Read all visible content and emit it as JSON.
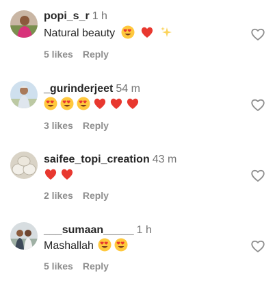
{
  "comments": [
    {
      "username": "popi_s_r",
      "time": "1 h",
      "text": "Natural beauty",
      "emojis": [
        "heart-eyes-emoji",
        "red-heart-emoji",
        "sparkles-emoji"
      ],
      "likes": "5 likes",
      "reply": "Reply"
    },
    {
      "username": "_gurinderjeet",
      "time": "54 m",
      "text": "",
      "emojis": [
        "heart-eyes-emoji",
        "heart-eyes-emoji",
        "heart-eyes-emoji",
        "red-heart-emoji",
        "red-heart-emoji",
        "red-heart-emoji"
      ],
      "likes": "3 likes",
      "reply": "Reply"
    },
    {
      "username": "saifee_topi_creation",
      "time": "43 m",
      "text": "",
      "emojis": [
        "red-heart-emoji",
        "red-heart-emoji"
      ],
      "likes": "2 likes",
      "reply": "Reply"
    },
    {
      "username": "___sumaan_____",
      "time": "1 h",
      "text": "Mashallah",
      "emojis": [
        "heart-eyes-emoji",
        "heart-eyes-emoji"
      ],
      "likes": "5 likes",
      "reply": "Reply"
    }
  ],
  "colors": {
    "username": "#262626",
    "secondary": "#8e8e8e",
    "heart": "#e8382f",
    "emoji_face": "#ffc83d"
  },
  "icons": {
    "like": "heart-outline-icon"
  }
}
